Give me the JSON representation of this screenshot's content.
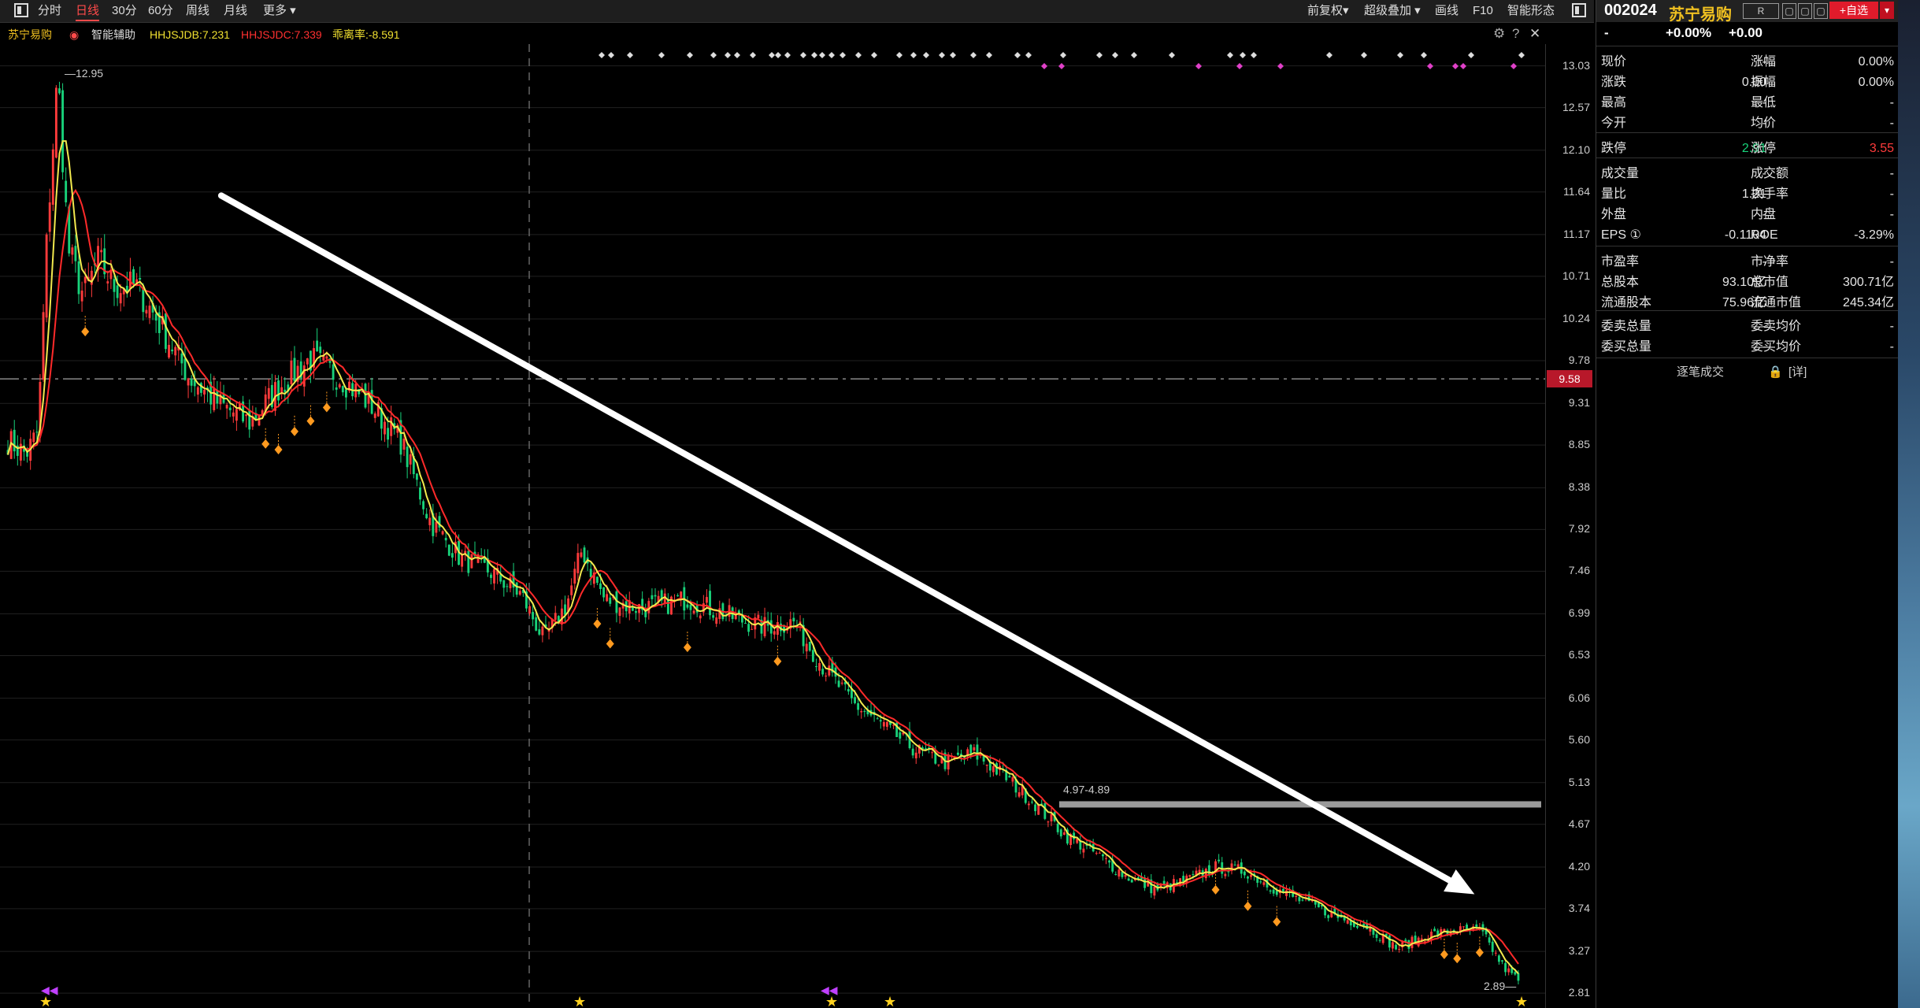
{
  "toolbar": {
    "left": [
      {
        "label": "分时",
        "active": false
      },
      {
        "label": "日线",
        "active": true
      },
      {
        "label": "30分",
        "active": false
      },
      {
        "label": "60分",
        "active": false
      },
      {
        "label": "周线",
        "active": false
      },
      {
        "label": "月线",
        "active": false
      },
      {
        "label": "更多 ▾",
        "active": false
      }
    ],
    "right": [
      "前复权▾",
      "超级叠加 ▾",
      "画线",
      "F10",
      "智能形态"
    ]
  },
  "infoline": {
    "name": "苏宁易购",
    "assist": "智能辅助",
    "hhjsjdb": "HHJSJDB:7.231",
    "hhjsjdc": "HHJSJDC:7.339",
    "distance": "乖离率:-8.591"
  },
  "colors": {
    "up": "#ff3b3b",
    "down": "#18d27a",
    "ma_fast": "#f2e94e",
    "ma_slow": "#ff2a2a",
    "marker": "#ff9a1f",
    "grid": "#202020"
  },
  "chart_data": {
    "type": "candlestick",
    "price_ticks": [
      "13.03",
      "12.57",
      "12.10",
      "11.64",
      "11.17",
      "10.71",
      "10.24",
      "9.78",
      "9.31",
      "8.85",
      "8.38",
      "7.92",
      "7.46",
      "6.99",
      "6.53",
      "6.06",
      "5.60",
      "5.13",
      "4.67",
      "4.20",
      "3.74",
      "3.27",
      "2.81"
    ],
    "ylim": [
      2.75,
      13.2
    ],
    "current_price": "9.58",
    "high_label": "12.95",
    "low_label": "2.89",
    "zone_label": "4.97-4.89",
    "zone_range": [
      4.89,
      4.97
    ],
    "trend_arrow": {
      "from": [
        0.142,
        11.6
      ],
      "to": [
        0.97,
        3.9
      ]
    },
    "anchors": [
      [
        0,
        8.9
      ],
      [
        0.012,
        8.75
      ],
      [
        0.02,
        9.0
      ],
      [
        0.026,
        11.2
      ],
      [
        0.033,
        12.95
      ],
      [
        0.04,
        11.0
      ],
      [
        0.05,
        10.5
      ],
      [
        0.06,
        10.9
      ],
      [
        0.07,
        10.6
      ],
      [
        0.085,
        10.6
      ],
      [
        0.1,
        10.2
      ],
      [
        0.12,
        9.6
      ],
      [
        0.14,
        9.3
      ],
      [
        0.16,
        9.1
      ],
      [
        0.18,
        9.5
      ],
      [
        0.2,
        9.8
      ],
      [
        0.22,
        9.6
      ],
      [
        0.24,
        9.3
      ],
      [
        0.26,
        8.9
      ],
      [
        0.28,
        8.0
      ],
      [
        0.3,
        7.6
      ],
      [
        0.32,
        7.45
      ],
      [
        0.34,
        7.2
      ],
      [
        0.355,
        6.7
      ],
      [
        0.37,
        7.1
      ],
      [
        0.38,
        7.7
      ],
      [
        0.395,
        7.15
      ],
      [
        0.42,
        7.05
      ],
      [
        0.45,
        7.15
      ],
      [
        0.48,
        6.95
      ],
      [
        0.5,
        6.85
      ],
      [
        0.52,
        6.9
      ],
      [
        0.54,
        6.4
      ],
      [
        0.56,
        6.0
      ],
      [
        0.58,
        5.75
      ],
      [
        0.6,
        5.5
      ],
      [
        0.62,
        5.35
      ],
      [
        0.64,
        5.45
      ],
      [
        0.66,
        5.2
      ],
      [
        0.68,
        4.9
      ],
      [
        0.7,
        4.55
      ],
      [
        0.72,
        4.35
      ],
      [
        0.74,
        4.1
      ],
      [
        0.76,
        3.95
      ],
      [
        0.78,
        4.05
      ],
      [
        0.8,
        4.2
      ],
      [
        0.82,
        4.15
      ],
      [
        0.84,
        3.95
      ],
      [
        0.86,
        3.8
      ],
      [
        0.88,
        3.65
      ],
      [
        0.9,
        3.55
      ],
      [
        0.92,
        3.3
      ],
      [
        0.94,
        3.45
      ],
      [
        0.96,
        3.5
      ],
      [
        0.975,
        3.5
      ],
      [
        0.99,
        3.1
      ],
      [
        1.0,
        2.95
      ]
    ],
    "marker_positions": [
      0.052,
      0.17,
      0.18,
      0.19,
      0.2,
      0.212,
      0.39,
      0.398,
      0.45,
      0.51,
      0.8,
      0.82,
      0.84,
      0.952,
      0.96,
      0.975
    ]
  },
  "quote": {
    "code": "002024",
    "name": "苏宁易购",
    "badge_r": "R",
    "add_label": "+自选",
    "change_pct": "+0.00%",
    "change_amt": "+0.00",
    "dash": "-",
    "rows": [
      [
        "现价",
        "-",
        "涨幅",
        "0.00%"
      ],
      [
        "涨跌",
        "0.00",
        "振幅",
        "0.00%"
      ],
      [
        "最高",
        "-",
        "最低",
        "-"
      ],
      [
        "今开",
        "-",
        "均价",
        "-"
      ],
      [
        "跌停",
        "2.91",
        "涨停",
        "3.55"
      ],
      [
        "成交量",
        "-",
        "成交额",
        "-"
      ],
      [
        "量比",
        "1.21",
        "换手率",
        "-"
      ],
      [
        "外盘",
        "-",
        "内盘",
        "-"
      ],
      [
        "EPS ①",
        "-0.1104",
        "ROE",
        "-3.29%"
      ],
      [
        "市盈率",
        "-",
        "市净率",
        "-"
      ],
      [
        "总股本",
        "93.10亿",
        "总市值",
        "300.71亿"
      ],
      [
        "流通股本",
        "75.96亿",
        "流通市值",
        "245.34亿"
      ],
      [
        "委卖总量",
        "-",
        "委卖均价",
        "-"
      ],
      [
        "委买总量",
        "-",
        "委买均价",
        "-"
      ]
    ],
    "footer_left": "逐笔成交",
    "footer_right": "[详]"
  }
}
